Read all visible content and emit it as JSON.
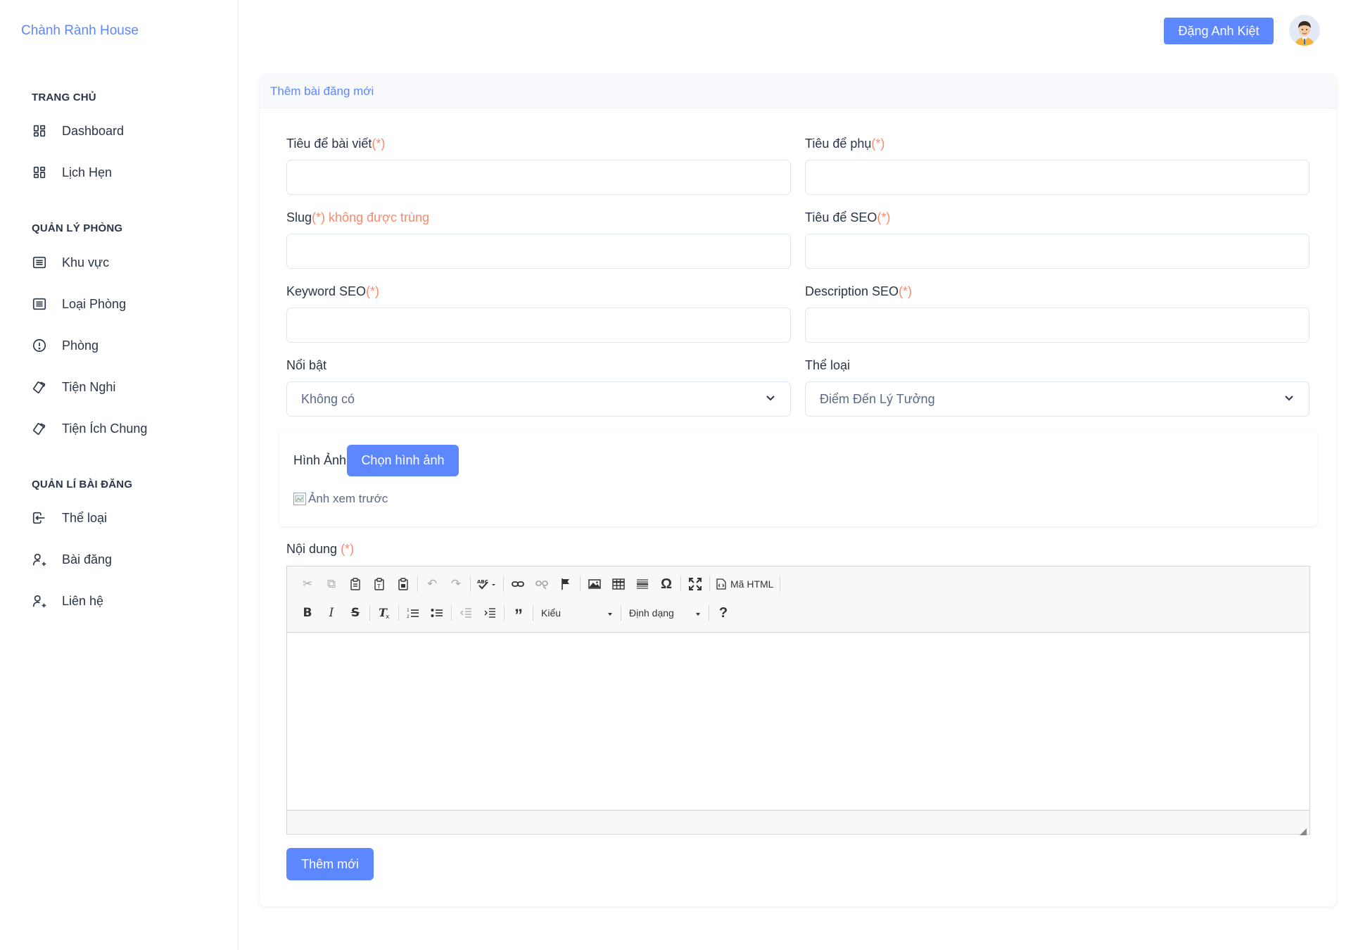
{
  "sidebar": {
    "brand": "Chành Rành House",
    "sections": [
      {
        "title": "TRANG CHỦ",
        "items": [
          {
            "label": "Dashboard",
            "icon": "layout-grid-icon"
          },
          {
            "label": "Lịch Hẹn",
            "icon": "layout-grid-icon"
          }
        ]
      },
      {
        "title": "QUẢN LÝ PHÒNG",
        "items": [
          {
            "label": "Khu vực",
            "icon": "list-icon"
          },
          {
            "label": "Loại Phòng",
            "icon": "list-icon"
          },
          {
            "label": "Phòng",
            "icon": "alert-circle-icon"
          },
          {
            "label": "Tiện Nghi",
            "icon": "cards-icon"
          },
          {
            "label": "Tiện Ích Chung",
            "icon": "cards-icon"
          }
        ]
      },
      {
        "title": "QUẢN LÍ BÀI ĐĂNG",
        "items": [
          {
            "label": "Thể loại",
            "icon": "login-icon"
          },
          {
            "label": "Bài đăng",
            "icon": "user-plus-icon"
          },
          {
            "label": "Liên hệ",
            "icon": "user-plus-icon"
          }
        ]
      }
    ]
  },
  "header": {
    "user_name": "Đặng Anh Kiệt"
  },
  "card": {
    "title": "Thêm bài đăng mới"
  },
  "form": {
    "required_mark": "(*)",
    "title_label": "Tiêu để bài viết",
    "subtitle_label": "Tiêu để phụ",
    "slug_label": "Slug",
    "slug_note": "không được trùng",
    "seo_title_label": "Tiêu để SEO",
    "keyword_label": "Keyword SEO",
    "description_label": "Description SEO",
    "featured_label": "Nổi bật",
    "featured_value": "Không có",
    "category_label": "Thể loại",
    "category_value": "Điểm Đến Lý Tưởng",
    "image_label": "Hình Ảnh",
    "choose_image": "Chọn hình ảnh",
    "preview_alt": "Ảnh xem trước",
    "content_label": "Nội dung",
    "submit": "Thêm mới"
  },
  "editor": {
    "source_label": "Mã HTML",
    "styles_label": "Kiểu",
    "format_label": "Định dạng",
    "help": "?"
  }
}
